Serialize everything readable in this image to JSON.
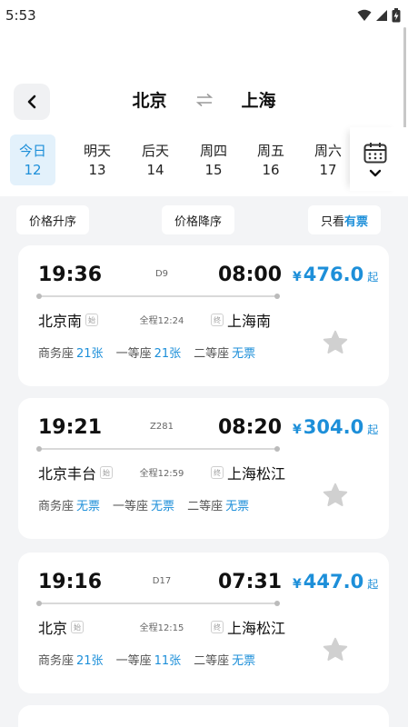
{
  "status_bar": {
    "time": "5:53"
  },
  "header": {
    "from": "北京",
    "to": "上海"
  },
  "dates": [
    {
      "name": "今日",
      "num": "12",
      "active": true
    },
    {
      "name": "明天",
      "num": "13"
    },
    {
      "name": "后天",
      "num": "14"
    },
    {
      "name": "周四",
      "num": "15"
    },
    {
      "name": "周五",
      "num": "16"
    },
    {
      "name": "周六",
      "num": "17"
    }
  ],
  "sort": {
    "asc": "价格升序",
    "desc": "价格降序",
    "only_prefix": "只看",
    "only_highlight": "有票"
  },
  "trains": [
    {
      "dep_time": "19:36",
      "train_no": "D9",
      "arr_time": "08:00",
      "currency": "¥",
      "price": "476.0",
      "price_suffix": "起",
      "dep_station": "北京南",
      "dep_tag": "始",
      "duration": "全程12:24",
      "arr_tag": "终",
      "arr_station": "上海南",
      "seats": [
        {
          "name": "商务座",
          "avail": "21张"
        },
        {
          "name": "一等座",
          "avail": "21张"
        },
        {
          "name": "二等座",
          "avail": "无票"
        }
      ]
    },
    {
      "dep_time": "19:21",
      "train_no": "Z281",
      "arr_time": "08:20",
      "currency": "¥",
      "price": "304.0",
      "price_suffix": "起",
      "dep_station": "北京丰台",
      "dep_tag": "始",
      "duration": "全程12:59",
      "arr_tag": "终",
      "arr_station": "上海松江",
      "seats": [
        {
          "name": "商务座",
          "avail": "无票"
        },
        {
          "name": "一等座",
          "avail": "无票"
        },
        {
          "name": "二等座",
          "avail": "无票"
        }
      ]
    },
    {
      "dep_time": "19:16",
      "train_no": "D17",
      "arr_time": "07:31",
      "currency": "¥",
      "price": "447.0",
      "price_suffix": "起",
      "dep_station": "北京",
      "dep_tag": "始",
      "duration": "全程12:15",
      "arr_tag": "终",
      "arr_station": "上海松江",
      "seats": [
        {
          "name": "商务座",
          "avail": "21张"
        },
        {
          "name": "一等座",
          "avail": "11张"
        },
        {
          "name": "二等座",
          "avail": "无票"
        }
      ]
    }
  ],
  "icons": {
    "back": "chevron-left-icon",
    "swap": "swap-arrows-icon",
    "calendar": "calendar-icon",
    "expand": "chevron-down-icon",
    "favorite": "star-icon"
  },
  "colors": {
    "accent": "#1d8fd9",
    "background": "#f3f4f6"
  }
}
